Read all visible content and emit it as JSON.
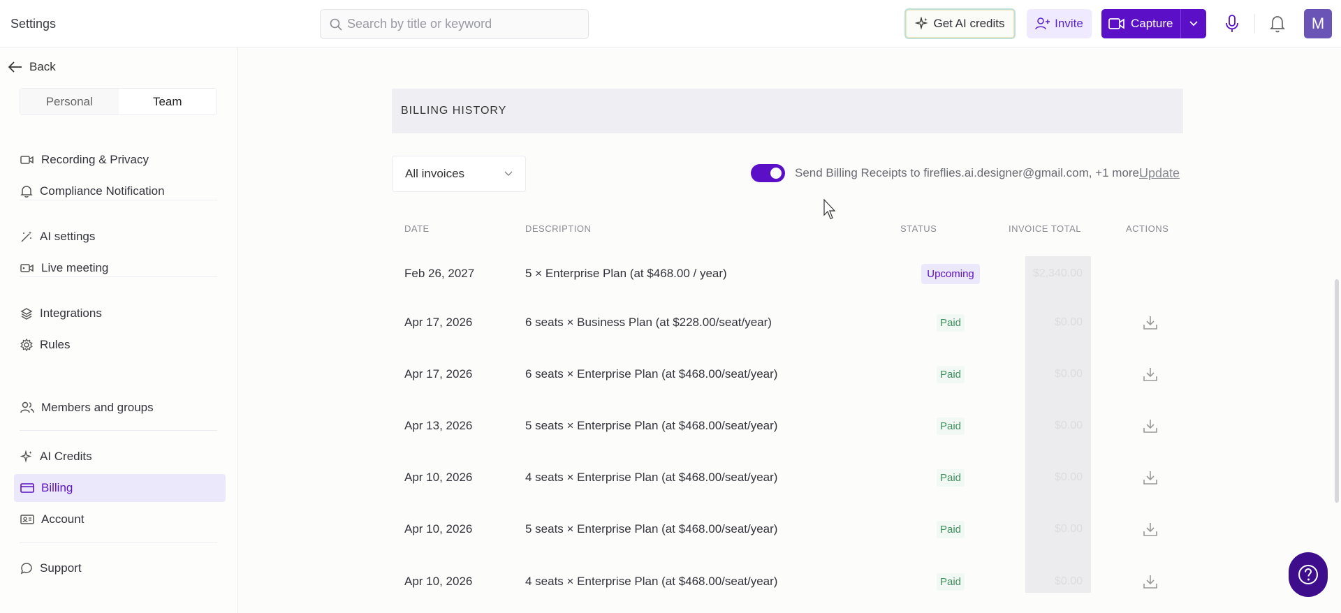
{
  "header": {
    "title": "Settings",
    "search_placeholder": "Search by title or keyword",
    "credits_label": "Get AI credits",
    "invite_label": "Invite",
    "capture_label": "Capture",
    "avatar_initial": "M"
  },
  "sidebar": {
    "back_label": "Back",
    "tabs": [
      "Personal",
      "Team"
    ],
    "active_tab": "Team",
    "items": [
      {
        "label": "Recording & Privacy",
        "icon": "video-icon"
      },
      {
        "label": "Compliance Notification",
        "icon": "bell-icon"
      },
      {
        "label": "AI settings",
        "icon": "magic-wand-icon"
      },
      {
        "label": "Live meeting",
        "icon": "live-video-icon"
      },
      {
        "label": "Integrations",
        "icon": "layers-icon"
      },
      {
        "label": "Rules",
        "icon": "gear-icon"
      },
      {
        "label": "Members and groups",
        "icon": "users-icon"
      },
      {
        "label": "AI Credits",
        "icon": "sparkle-icon"
      },
      {
        "label": "Billing",
        "icon": "credit-card-icon"
      },
      {
        "label": "Account",
        "icon": "id-card-icon"
      },
      {
        "label": "Support",
        "icon": "chat-icon"
      }
    ],
    "active_item": "Billing"
  },
  "billing": {
    "section_title": "BILLING HISTORY",
    "filter_value": "All invoices",
    "receipts_toggle_on": true,
    "receipts_text": "Send Billing Receipts to fireflies.ai.designer@gmail.com, +1 more.",
    "update_label": "Update",
    "columns": {
      "date": "DATE",
      "description": "DESCRIPTION",
      "status": "STATUS",
      "total": "INVOICE TOTAL",
      "actions": "ACTIONS"
    },
    "rows": [
      {
        "date": "Feb 26, 2027",
        "description": "5 × Enterprise Plan (at $468.00 / year)",
        "status": "Upcoming",
        "total": "$2,340.00",
        "downloadable": false
      },
      {
        "date": "Apr 17, 2026",
        "description": "6 seats × Business Plan (at $228.00/seat/year)",
        "status": "Paid",
        "total": "$0.00",
        "downloadable": true
      },
      {
        "date": "Apr 17, 2026",
        "description": "6 seats × Enterprise Plan (at $468.00/seat/year)",
        "status": "Paid",
        "total": "$0.00",
        "downloadable": true
      },
      {
        "date": "Apr 13, 2026",
        "description": "5 seats × Enterprise Plan (at $468.00/seat/year)",
        "status": "Paid",
        "total": "$0.00",
        "downloadable": true
      },
      {
        "date": "Apr 10, 2026",
        "description": "4 seats × Enterprise Plan (at $468.00/seat/year)",
        "status": "Paid",
        "total": "$0.00",
        "downloadable": true
      },
      {
        "date": "Apr 10, 2026",
        "description": "5 seats × Enterprise Plan (at $468.00/seat/year)",
        "status": "Paid",
        "total": "$0.00",
        "downloadable": true
      },
      {
        "date": "Apr 10, 2026",
        "description": "4 seats × Enterprise Plan (at $468.00/seat/year)",
        "status": "Paid",
        "total": "$0.00",
        "downloadable": true
      }
    ]
  },
  "colors": {
    "accent": "#5b10c8",
    "paid": "#3e8f5d",
    "active_nav_bg": "#ece8fb"
  }
}
